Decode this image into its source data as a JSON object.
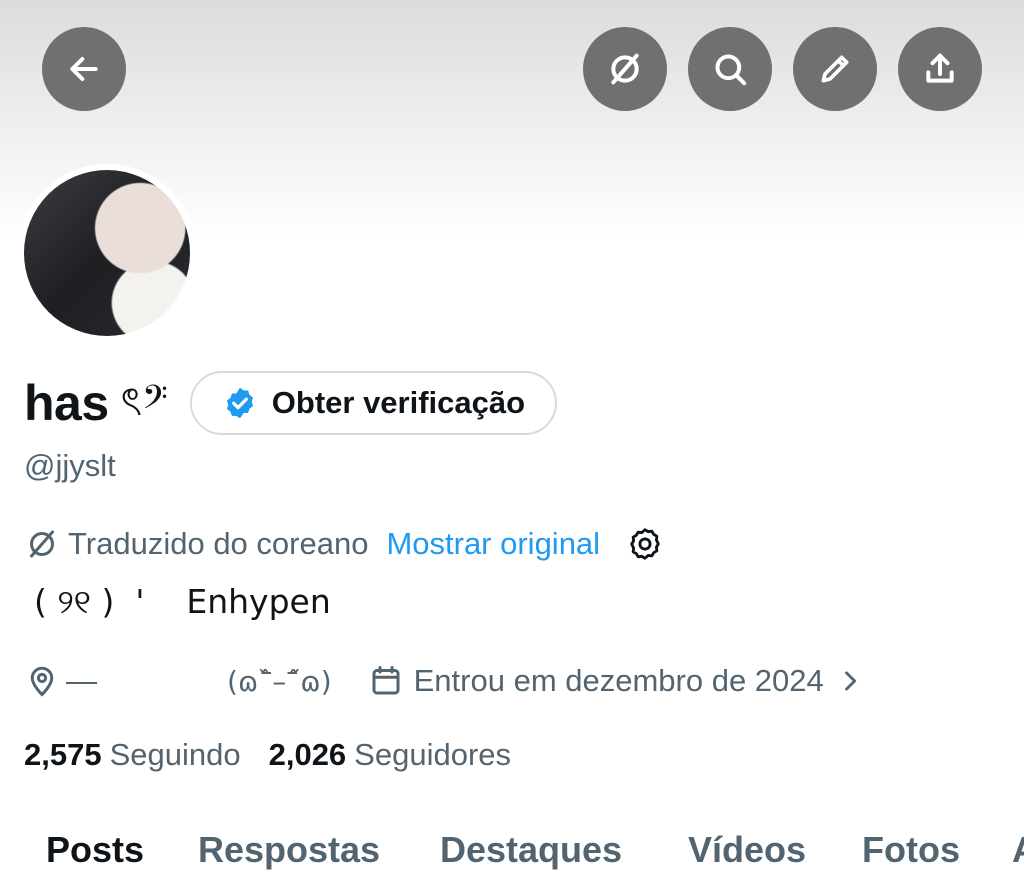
{
  "header": {
    "back_icon": "arrow-left-icon",
    "buttons": [
      "translate-off-icon",
      "search-icon",
      "pencil-icon",
      "share-icon"
    ]
  },
  "profile": {
    "display_name": "has",
    "name_decoration": "ৎ𝄢",
    "verify_button_label": "Obter verificação",
    "handle": "@jjyslt",
    "translation_note": "Traduzido do coreano",
    "show_original_link": "Mostrar original",
    "bio": "( ୨୧ )  '    Enhypen",
    "location": "—",
    "location_extra": "(ɷˆ᷅–ˆ᷄ɷ)",
    "joined": "Entrou em dezembro de 2024"
  },
  "stats": {
    "following_count": "2,575",
    "following_label": "Seguindo",
    "followers_count": "2,026",
    "followers_label": "Seguidores"
  },
  "tabs": [
    {
      "label": "Posts",
      "active": true
    },
    {
      "label": "Respostas",
      "active": false
    },
    {
      "label": "Destaques",
      "active": false
    },
    {
      "label": "Vídeos",
      "active": false
    },
    {
      "label": "Fotos",
      "active": false
    },
    {
      "label": "A",
      "active": false
    }
  ],
  "colors": {
    "accent": "#1d9bf0",
    "text": "#0f1419",
    "muted": "#536471",
    "header_button": "#707070"
  }
}
